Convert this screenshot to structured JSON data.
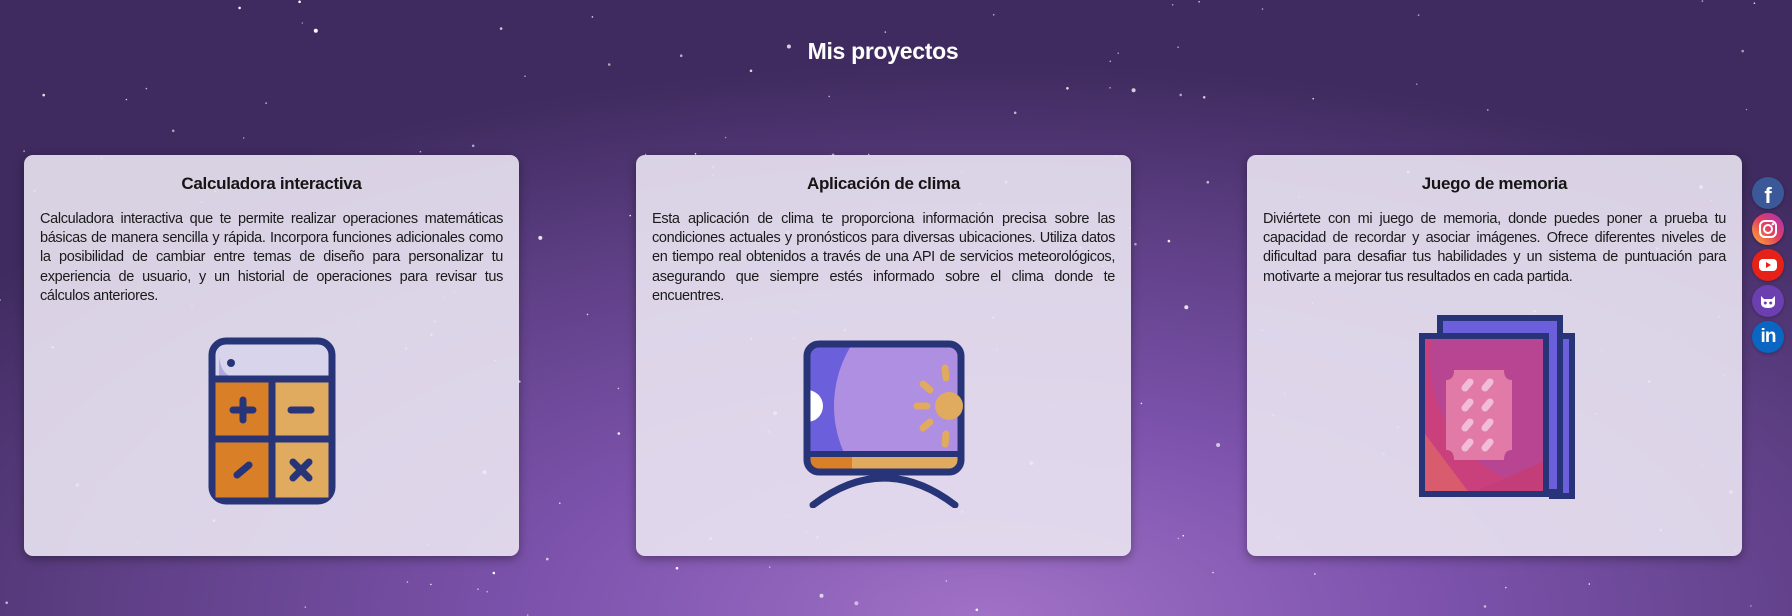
{
  "page": {
    "title": "Mis proyectos"
  },
  "projects": [
    {
      "title": "Calculadora interactiva",
      "description": "Calculadora interactiva que te permite realizar operaciones matemáticas básicas de manera sencilla y rápida. Incorpora funciones adicionales como la posibilidad de cambiar entre temas de diseño para personalizar tu experiencia de usuario, y un historial de operaciones para revisar tus cálculos anteriores.",
      "icon": "calculator-icon"
    },
    {
      "title": "Aplicación de clima",
      "description": "Esta aplicación de clima te proporciona información precisa sobre las condiciones actuales y pronósticos para diversas ubicaciones. Utiliza datos en tiempo real obtenidos a través de una API de servicios meteorológicos, asegurando que siempre estés informado sobre el clima donde te encuentres.",
      "icon": "weather-screen-icon"
    },
    {
      "title": "Juego de memoria",
      "description": "Diviértete con mi juego de memoria, donde puedes poner a prueba tu capacidad de recordar y asociar imágenes. Ofrece diferentes niveles de dificultad para desafiar tus habilidades y un sistema de puntuación para motivarte a mejorar tus resultados en cada partida.",
      "icon": "memory-cards-icon"
    }
  ],
  "social": [
    {
      "name": "facebook",
      "icon": "facebook-icon",
      "color": "#3b5998"
    },
    {
      "name": "instagram",
      "icon": "instagram-icon",
      "color": "#d6249f"
    },
    {
      "name": "youtube",
      "icon": "youtube-icon",
      "color": "#e62117"
    },
    {
      "name": "github",
      "icon": "github-icon",
      "color": "#6f42c1"
    },
    {
      "name": "linkedin",
      "icon": "linkedin-icon",
      "color": "#0a66c2"
    }
  ]
}
